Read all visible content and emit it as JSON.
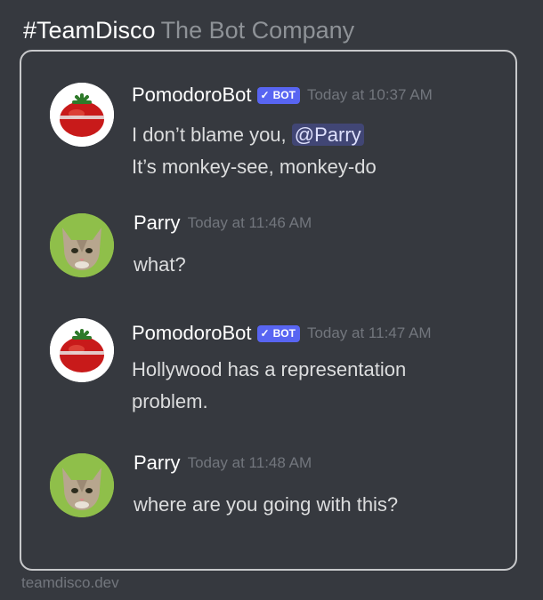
{
  "brand": {
    "name": "#TeamDisco",
    "tagline": "The Bot Company"
  },
  "messages": [
    {
      "author": "PomodoroBot",
      "badge": "BOT",
      "timestamp": "Today at 10:37 AM",
      "line1_prefix": "I don’t blame you, ",
      "mention": "@Parry",
      "line2": "It’s monkey-see, monkey-do",
      "avatar_icon": "tomato-timer-icon"
    },
    {
      "author": "Parry",
      "timestamp": "Today at 11:46 AM",
      "line1": "what?",
      "avatar_icon": "kitten-icon"
    },
    {
      "author": "PomodoroBot",
      "badge": "BOT",
      "timestamp": "Today at 11:47 AM",
      "line1": "Hollywood has a representation",
      "line2": "problem.",
      "avatar_icon": "tomato-timer-icon"
    },
    {
      "author": "Parry",
      "timestamp": "Today at 11:48 AM",
      "line1": "where are you going with this?",
      "avatar_icon": "kitten-icon"
    }
  ],
  "footer": {
    "text": "teamdisco.dev"
  },
  "colors": {
    "background": "#36393f",
    "mention_bg": "#414675",
    "badge": "#5865f2",
    "timestamp": "#72767d"
  }
}
